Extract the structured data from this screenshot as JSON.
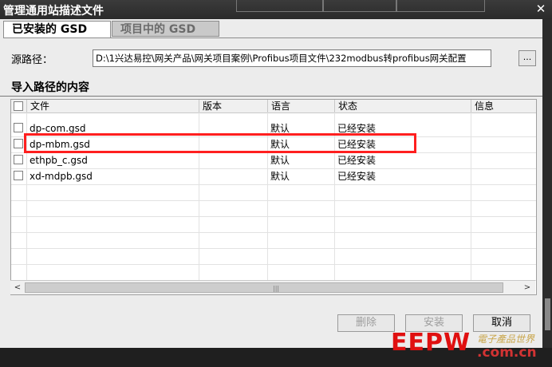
{
  "window": {
    "title": "管理通用站描述文件",
    "close_glyph": "✕"
  },
  "tabs": [
    {
      "label": "已安装的 GSD",
      "active": true
    },
    {
      "label": "项目中的 GSD",
      "active": false
    }
  ],
  "source": {
    "label": "源路径：",
    "value": "D:\\1兴达易控\\网关产品\\网关项目案例\\Profibus项目文件\\232modbus转profibus网关配置",
    "browse_label": "..."
  },
  "content": {
    "title": "导入路径的内容",
    "columns": [
      "文件",
      "版本",
      "语言",
      "状态",
      "信息"
    ],
    "rows": [
      {
        "file": "dp-com.gsd",
        "version": "",
        "language": "默认",
        "status": "已经安装",
        "info": "",
        "checked": false,
        "highlighted": true
      },
      {
        "file": "dp-mbm.gsd",
        "version": "",
        "language": "默认",
        "status": "已经安装",
        "info": "",
        "checked": false
      },
      {
        "file": "ethpb_c.gsd",
        "version": "",
        "language": "默认",
        "status": "已经安装",
        "info": "",
        "checked": false
      },
      {
        "file": "xd-mdpb.gsd",
        "version": "",
        "language": "默认",
        "status": "已经安装",
        "info": "",
        "checked": false
      }
    ]
  },
  "scrollbar": {
    "left_glyph": "<",
    "right_glyph": ">",
    "grip_glyph": "|||"
  },
  "buttons": {
    "delete": "删除",
    "install": "安装",
    "cancel": "取消"
  },
  "watermark": {
    "logo": "EEPW",
    "cn_text": "電子產品世界",
    "url": ".com.cn"
  },
  "colors": {
    "highlight": "#ff1f1f",
    "titlebar": "#2f2f2f",
    "dialog_bg": "#ececec"
  }
}
